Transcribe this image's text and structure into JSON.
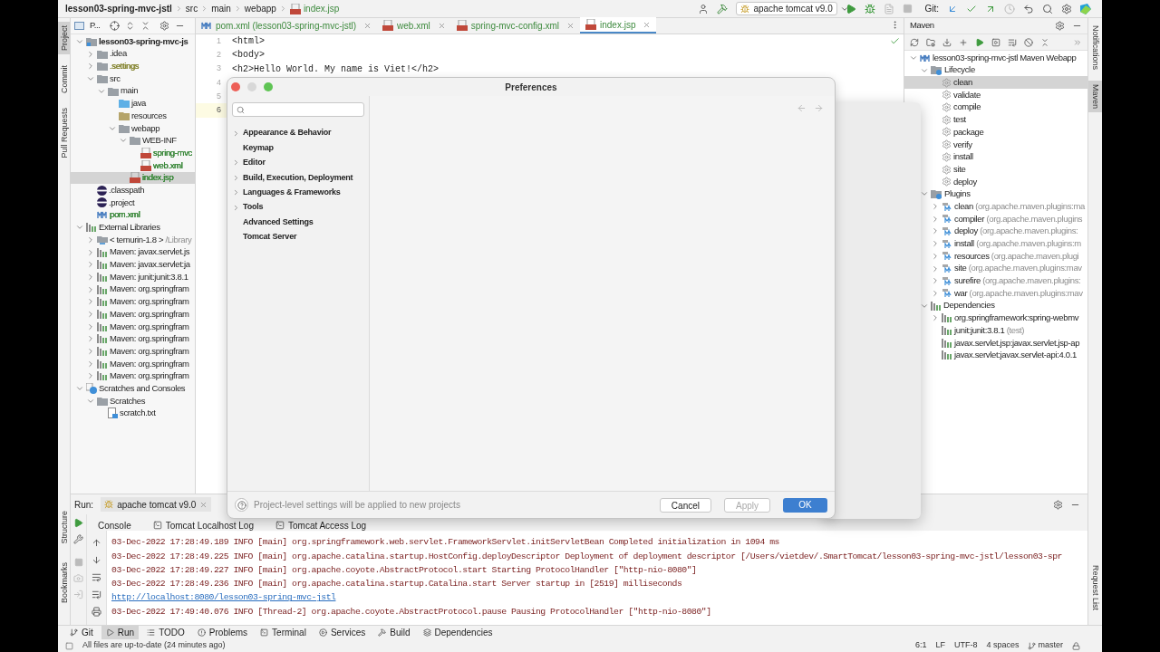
{
  "breadcrumb": [
    {
      "label": "lesson03-spring-mvc-jstl",
      "kind": "project"
    },
    {
      "label": "src",
      "kind": "folder"
    },
    {
      "label": "main",
      "kind": "folder"
    },
    {
      "label": "webapp",
      "kind": "folder"
    },
    {
      "label": "index.jsp",
      "kind": "jsp"
    }
  ],
  "toolbar": {
    "run_config": "apache tomcat v9.0",
    "git_label": "Git:"
  },
  "left_stripe": {
    "top": [
      {
        "label": "Project",
        "selected": true
      },
      {
        "label": "Commit",
        "selected": false
      },
      {
        "label": "Pull Requests",
        "selected": false
      }
    ],
    "bottom": [
      {
        "label": "Structure",
        "selected": false
      },
      {
        "label": "Bookmarks",
        "selected": false
      }
    ]
  },
  "right_stripe": [
    {
      "label": "Notifications",
      "selected": false
    },
    {
      "label": "Maven",
      "selected": true
    },
    {
      "label": "Request List",
      "selected": false
    }
  ],
  "project_panel": {
    "title": "P...",
    "tree": [
      {
        "label": "lesson03-spring-mvc-js",
        "kind": "module",
        "expanded": true,
        "selected": false,
        "children": [
          {
            "label": ".idea",
            "kind": "folder",
            "expanded": false,
            "selected": false
          },
          {
            "label": ".settings",
            "kind": "folder",
            "expanded": false,
            "selected": false,
            "color": "#8a8a3a"
          },
          {
            "label": "src",
            "kind": "folder",
            "expanded": true,
            "selected": false,
            "children": [
              {
                "label": "main",
                "kind": "folder",
                "expanded": true,
                "selected": false,
                "children": [
                  {
                    "label": "java",
                    "kind": "source-folder",
                    "selected": false
                  },
                  {
                    "label": "resources",
                    "kind": "resource-folder",
                    "selected": false
                  },
                  {
                    "label": "webapp",
                    "kind": "folder",
                    "expanded": true,
                    "selected": false,
                    "children": [
                      {
                        "label": "WEB-INF",
                        "kind": "folder",
                        "expanded": true,
                        "selected": false,
                        "children": [
                          {
                            "label": "spring-mvc",
                            "kind": "xml",
                            "selected": false,
                            "color": "#3f8b3f"
                          },
                          {
                            "label": "web.xml",
                            "kind": "xml",
                            "selected": false,
                            "color": "#3f8b3f"
                          }
                        ]
                      },
                      {
                        "label": "index.jsp",
                        "kind": "jsp",
                        "selected": true,
                        "color": "#3f8b3f"
                      }
                    ]
                  }
                ]
              }
            ]
          },
          {
            "label": ".classpath",
            "kind": "eclipse",
            "selected": false
          },
          {
            "label": ".project",
            "kind": "eclipse",
            "selected": false
          },
          {
            "label": "pom.xml",
            "kind": "maven",
            "selected": false,
            "color": "#3f8b3f"
          }
        ]
      },
      {
        "label": "External Libraries",
        "kind": "library",
        "expanded": true,
        "selected": false,
        "children": [
          {
            "label": "< temurin-1.8 >",
            "detail": "/Library",
            "kind": "jdk",
            "expanded": false,
            "selected": false
          },
          {
            "label": "Maven: javax.servlet.js",
            "kind": "library",
            "expanded": false,
            "selected": false
          },
          {
            "label": "Maven: javax.servlet:ja",
            "kind": "library",
            "expanded": false,
            "selected": false
          },
          {
            "label": "Maven: junit:junit:3.8.1",
            "kind": "library",
            "expanded": false,
            "selected": false
          },
          {
            "label": "Maven: org.springfram",
            "kind": "library",
            "expanded": false,
            "selected": false
          },
          {
            "label": "Maven: org.springfram",
            "kind": "library",
            "expanded": false,
            "selected": false
          },
          {
            "label": "Maven: org.springfram",
            "kind": "library",
            "expanded": false,
            "selected": false
          },
          {
            "label": "Maven: org.springfram",
            "kind": "library",
            "expanded": false,
            "selected": false
          },
          {
            "label": "Maven: org.springfram",
            "kind": "library",
            "expanded": false,
            "selected": false
          },
          {
            "label": "Maven: org.springfram",
            "kind": "library",
            "expanded": false,
            "selected": false
          },
          {
            "label": "Maven: org.springfram",
            "kind": "library",
            "expanded": false,
            "selected": false
          },
          {
            "label": "Maven: org.springfram",
            "kind": "library",
            "expanded": false,
            "selected": false
          }
        ]
      },
      {
        "label": "Scratches and Consoles",
        "kind": "scratches",
        "expanded": true,
        "selected": false,
        "children": [
          {
            "label": "Scratches",
            "kind": "folder",
            "expanded": true,
            "selected": false,
            "children": [
              {
                "label": "scratch.txt",
                "kind": "text",
                "selected": false
              }
            ]
          }
        ]
      }
    ]
  },
  "editor": {
    "tabs": [
      {
        "label": "pom.xml (lesson03-spring-mvc-jstl)",
        "kind": "maven",
        "selected": false
      },
      {
        "label": "web.xml",
        "kind": "xml",
        "selected": false
      },
      {
        "label": "spring-mvc-config.xml",
        "kind": "xml",
        "selected": false
      },
      {
        "label": "index.jsp",
        "kind": "jsp",
        "selected": true
      }
    ],
    "lines": [
      {
        "number": "1",
        "code": "<html>",
        "current": false
      },
      {
        "number": "2",
        "code": "<body>",
        "current": false
      },
      {
        "number": "3",
        "code": "<h2>Hello World. My name is Viet!</h2>",
        "current": false
      },
      {
        "number": "4",
        "current": false
      },
      {
        "number": "5",
        "current": false
      },
      {
        "number": "6",
        "current": true
      }
    ]
  },
  "maven": {
    "title": "Maven",
    "tree": [
      {
        "label": "lesson03-spring-mvc-jstl Maven Webapp",
        "kind": "maven",
        "expanded": true,
        "selected": false,
        "children": [
          {
            "label": "Lifecycle",
            "kind": "lifecycle",
            "expanded": true,
            "selected": false,
            "children": [
              {
                "label": "clean",
                "kind": "goal",
                "selected": true
              },
              {
                "label": "validate",
                "kind": "goal",
                "selected": false
              },
              {
                "label": "compile",
                "kind": "goal",
                "selected": false
              },
              {
                "label": "test",
                "kind": "goal",
                "selected": false
              },
              {
                "label": "package",
                "kind": "goal",
                "selected": false
              },
              {
                "label": "verify",
                "kind": "goal",
                "selected": false
              },
              {
                "label": "install",
                "kind": "goal",
                "selected": false
              },
              {
                "label": "site",
                "kind": "goal",
                "selected": false
              },
              {
                "label": "deploy",
                "kind": "goal",
                "selected": false
              }
            ]
          },
          {
            "label": "Plugins",
            "kind": "lifecycle",
            "expanded": true,
            "selected": false,
            "children": [
              {
                "label": "clean",
                "detail": "(org.apache.maven.plugins:ma",
                "kind": "plugin",
                "expanded": false,
                "selected": false
              },
              {
                "label": "compiler",
                "detail": "(org.apache.maven.plugins",
                "kind": "plugin",
                "expanded": false,
                "selected": false
              },
              {
                "label": "deploy",
                "detail": "(org.apache.maven.plugins:",
                "kind": "plugin",
                "expanded": false,
                "selected": false
              },
              {
                "label": "install",
                "detail": "(org.apache.maven.plugins:m",
                "kind": "plugin",
                "expanded": false,
                "selected": false
              },
              {
                "label": "resources",
                "detail": "(org.apache.maven.plugi",
                "kind": "plugin",
                "expanded": false,
                "selected": false
              },
              {
                "label": "site",
                "detail": "(org.apache.maven.plugins:mav",
                "kind": "plugin",
                "expanded": false,
                "selected": false
              },
              {
                "label": "surefire",
                "detail": "(org.apache.maven.plugins:",
                "kind": "plugin",
                "expanded": false,
                "selected": false
              },
              {
                "label": "war",
                "detail": "(org.apache.maven.plugins:mav",
                "kind": "plugin",
                "expanded": false,
                "selected": false
              }
            ]
          },
          {
            "label": "Dependencies",
            "kind": "library",
            "expanded": true,
            "selected": false,
            "children": [
              {
                "label": "org.springframework:spring-webmv",
                "kind": "dependency",
                "expanded": false,
                "selected": false
              },
              {
                "label": "junit:junit:3.8.1",
                "detail": "(test)",
                "kind": "dependency",
                "selected": false
              },
              {
                "label": "javax.servlet.jsp:javax.servlet.jsp-ap",
                "kind": "dependency",
                "selected": false
              },
              {
                "label": "javax.servlet:javax.servlet-api:4.0.1",
                "kind": "dependency",
                "selected": false
              }
            ]
          }
        ]
      }
    ]
  },
  "dialog": {
    "title": "Preferences",
    "nav": [
      {
        "label": "Appearance & Behavior",
        "kind": "group"
      },
      {
        "label": "Keymap",
        "kind": "page"
      },
      {
        "label": "Editor",
        "kind": "group"
      },
      {
        "label": "Build, Execution, Deployment",
        "kind": "group"
      },
      {
        "label": "Languages & Frameworks",
        "kind": "group"
      },
      {
        "label": "Tools",
        "kind": "group"
      },
      {
        "label": "Advanced Settings",
        "kind": "page"
      },
      {
        "label": "Tomcat Server",
        "kind": "page"
      }
    ],
    "footer_text": "Project-level settings will be applied to new projects",
    "buttons": [
      {
        "label": "Cancel",
        "kind": "secondary",
        "disabled": false
      },
      {
        "label": "Apply",
        "kind": "secondary",
        "disabled": true
      },
      {
        "label": "OK",
        "kind": "primary",
        "disabled": false
      }
    ]
  },
  "run_panel": {
    "label": "Run:",
    "tab": "apache tomcat v9.0",
    "subtabs": [
      {
        "label": "Console",
        "kind": "console"
      },
      {
        "label": "Tomcat Localhost Log",
        "kind": "log"
      },
      {
        "label": "Tomcat Access Log",
        "kind": "log"
      }
    ],
    "lines": [
      {
        "kind": "log",
        "text": "03-Dec-2022 17:28:49.189 INFO [main] org.springframework.web.servlet.FrameworkServlet.initServletBean Completed initialization in 1094 ms"
      },
      {
        "kind": "log",
        "text": "03-Dec-2022 17:28:49.225 INFO [main] org.apache.catalina.startup.HostConfig.deployDescriptor Deployment of deployment descriptor [/Users/vietdev/.SmartTomcat/lesson03-spring-mvc-jstl/lesson03-spr"
      },
      {
        "kind": "log",
        "text": "03-Dec-2022 17:28:49.227 INFO [main] org.apache.coyote.AbstractProtocol.start Starting ProtocolHandler [\"http-nio-8080\"]"
      },
      {
        "kind": "log",
        "text": "03-Dec-2022 17:28:49.236 INFO [main] org.apache.catalina.startup.Catalina.start Server startup in [2519] milliseconds"
      },
      {
        "kind": "link",
        "text": "http://localhost:8080/lesson03-spring-mvc-jstl"
      },
      {
        "kind": "log",
        "text": "03-Dec-2022 17:49:40.076 INFO [Thread-2] org.apache.coyote.AbstractProtocol.pause Pausing ProtocolHandler [\"http-nio-8080\"]"
      }
    ]
  },
  "tool_tabs": [
    {
      "label": "Git",
      "kind": "git",
      "selected": false
    },
    {
      "label": "Run",
      "kind": "run",
      "selected": true
    },
    {
      "label": "TODO",
      "kind": "todo",
      "selected": false
    },
    {
      "label": "Problems",
      "kind": "problems",
      "selected": false
    },
    {
      "label": "Terminal",
      "kind": "terminal",
      "selected": false
    },
    {
      "label": "Services",
      "kind": "services",
      "selected": false
    },
    {
      "label": "Build",
      "kind": "build",
      "selected": false
    },
    {
      "label": "Dependencies",
      "kind": "dependencies",
      "selected": false
    }
  ],
  "status_bar": {
    "message": "All files are up-to-date (24 minutes ago)",
    "position": "6:1",
    "line_separator": "LF",
    "encoding": "UTF-8",
    "indent": "4 spaces",
    "branch": "master"
  }
}
